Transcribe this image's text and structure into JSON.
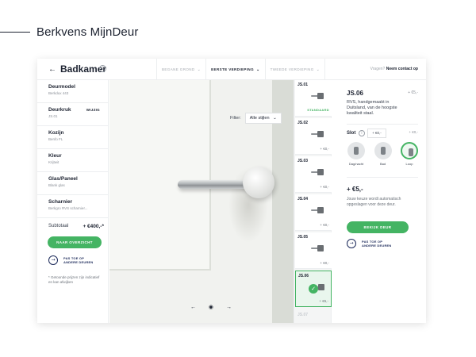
{
  "brand": {
    "title": "Berkvens MijnDeur"
  },
  "header": {
    "room_title": "Badkamer",
    "floor_tabs": [
      {
        "label": "BEGANE GROND",
        "active": false
      },
      {
        "label": "EERSTE VERDIEPING",
        "active": true
      },
      {
        "label": "TWEEDE VERDIEPING",
        "active": false
      }
    ],
    "help_question": "Vragen?",
    "help_link": "Neem contact op"
  },
  "sidebar": {
    "items": [
      {
        "label": "Deurmodel",
        "value": "Berkdux 443",
        "edit": ""
      },
      {
        "label": "Deurkruk",
        "value": "JS.01",
        "edit": "WIJZIG"
      },
      {
        "label": "Kozijn",
        "value": "Benfo FL",
        "edit": ""
      },
      {
        "label": "Kleur",
        "value": "Krijtwit",
        "edit": ""
      },
      {
        "label": "Glas/Paneel",
        "value": "Blank glas",
        "edit": ""
      },
      {
        "label": "Scharnier",
        "value": "Berkgro RVS scharnier...",
        "edit": ""
      }
    ],
    "subtotal_label": "Subtotaal",
    "subtotal_value": "+ €400,-*",
    "overview_button": "NAAR OVERZICHT",
    "apply_text": "PAS TOE OP ANDERE DEUREN",
    "footnote": "* Getoonde prijzen zijn indicatief en kan afwijken"
  },
  "preview": {
    "filter_label": "Filter:",
    "filter_value": "Alle stijlen"
  },
  "strip": {
    "tiles": [
      {
        "code": "JS.01",
        "price": "",
        "standard": "STANDAARD",
        "selected": false
      },
      {
        "code": "JS.02",
        "price": "+ €0,-",
        "standard": "",
        "selected": false
      },
      {
        "code": "JS.03",
        "price": "+ €0,-",
        "standard": "",
        "selected": false
      },
      {
        "code": "JS.04",
        "price": "+ €0,-",
        "standard": "",
        "selected": false
      },
      {
        "code": "JS.05",
        "price": "+ €0,-",
        "standard": "",
        "selected": false
      },
      {
        "code": "JS.06",
        "price": "+ €5,-",
        "standard": "",
        "selected": true
      }
    ],
    "faded_code": "JS.07"
  },
  "detail": {
    "code": "JS.06",
    "price_top": "+ €5,-",
    "description": "RVS, handgemaakt in Duitsland, van de hoogste kwaliteit staal.",
    "lock_label": "Slot",
    "lock_chip": "+ €0,-",
    "lock_chip2": "+ €0,-",
    "lock_options": [
      {
        "name": "Dag/nacht",
        "active": false
      },
      {
        "name": "Bad",
        "active": false
      },
      {
        "name": "Loop",
        "active": true
      }
    ],
    "total": "+ €5,-",
    "total_note": "Jouw keuze wordt automatisch opgeslagen voor deze deur.",
    "view_button": "BEKIJK DEUR",
    "apply_text": "PAS TOE OP ANDERE DEUREN"
  },
  "colors": {
    "accent": "#44b463",
    "text": "#1c2230",
    "navy": "#1c2a5a"
  },
  "icons": {
    "back": "arrow-left-icon",
    "info": "info-icon",
    "chevron": "chevron-down-icon",
    "arrow_circle": "arrow-right-circle-icon",
    "eye": "eye-icon",
    "check": "check-icon"
  }
}
